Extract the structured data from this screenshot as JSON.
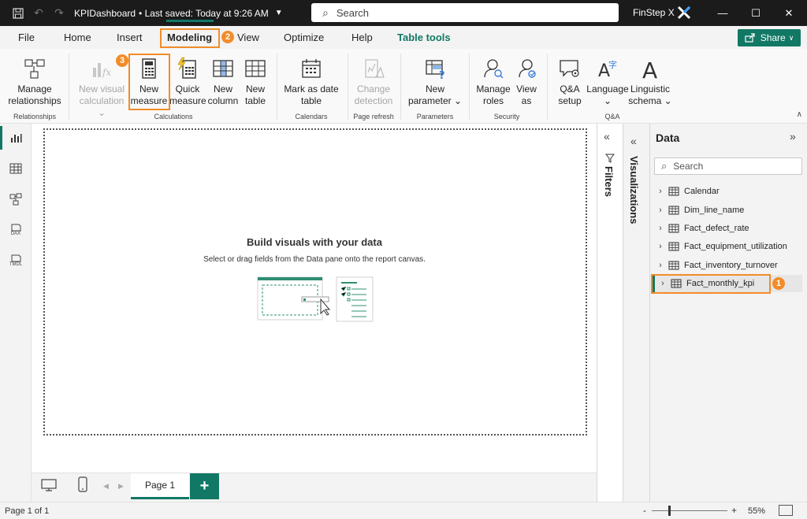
{
  "titlebar": {
    "file_title": "KPIDashboard",
    "saved_status": "• Last saved: Today at 9:26 AM",
    "search_placeholder": "Search",
    "user": "FinStep X"
  },
  "menu": {
    "tabs": [
      "File",
      "Home",
      "Insert",
      "Modeling",
      "View",
      "Optimize",
      "Help",
      "Table tools"
    ],
    "active_tab": "Modeling",
    "share_label": "Share"
  },
  "ribbon": {
    "manage_relationships": [
      "Manage",
      "relationships"
    ],
    "new_visual_calculation": [
      "New visual",
      "calculation ⌄"
    ],
    "new_measure": [
      "New",
      "measure"
    ],
    "quick_measure": [
      "Quick",
      "measure"
    ],
    "new_column": [
      "New",
      "column"
    ],
    "new_table": [
      "New",
      "table"
    ],
    "mark_as_date_table": [
      "Mark as date",
      "table"
    ],
    "change_detection": [
      "Change",
      "detection"
    ],
    "new_parameter": [
      "New",
      "parameter ⌄"
    ],
    "manage_roles": [
      "Manage",
      "roles"
    ],
    "view_as": [
      "View",
      "as"
    ],
    "qa_setup": [
      "Q&A",
      "setup"
    ],
    "language": [
      "Language",
      "⌄"
    ],
    "linguistic_schema": [
      "Linguistic",
      "schema ⌄"
    ],
    "groups": {
      "relationships": "Relationships",
      "calculations": "Calculations",
      "calendars": "Calendars",
      "page_refresh": "Page refresh",
      "parameters": "Parameters",
      "security": "Security",
      "qa": "Q&A"
    }
  },
  "leftrail": {
    "items": [
      "report-view",
      "table-view",
      "model-view",
      "dax-query-view",
      "tmdl-view"
    ],
    "dax_label": "DAX",
    "tmdl_label": "TMDL"
  },
  "canvas": {
    "empty_title": "Build visuals with your data",
    "empty_subtitle": "Select or drag fields from the Data pane onto the report canvas."
  },
  "pages": {
    "current": "Page 1",
    "add_label": "+"
  },
  "status": {
    "page_count": "Page 1 of 1",
    "zoom_minus": "-",
    "zoom_plus": "+",
    "zoom_level": "55%"
  },
  "panes": {
    "filters": "Filters",
    "visualizations": "Visualizations",
    "data_title": "Data",
    "data_search_placeholder": "Search",
    "tables": [
      "Calendar",
      "Dim_line_name",
      "Fact_defect_rate",
      "Fact_equipment_utilization",
      "Fact_inventory_turnover",
      "Fact_monthly_kpi"
    ],
    "selected_table": "Fact_monthly_kpi"
  },
  "annotations": {
    "badge_1": "1",
    "badge_2": "2",
    "badge_3": "3"
  },
  "colors": {
    "accent": "#117865",
    "annotation": "#f28c28",
    "titlebar": "#1b1b1b"
  }
}
